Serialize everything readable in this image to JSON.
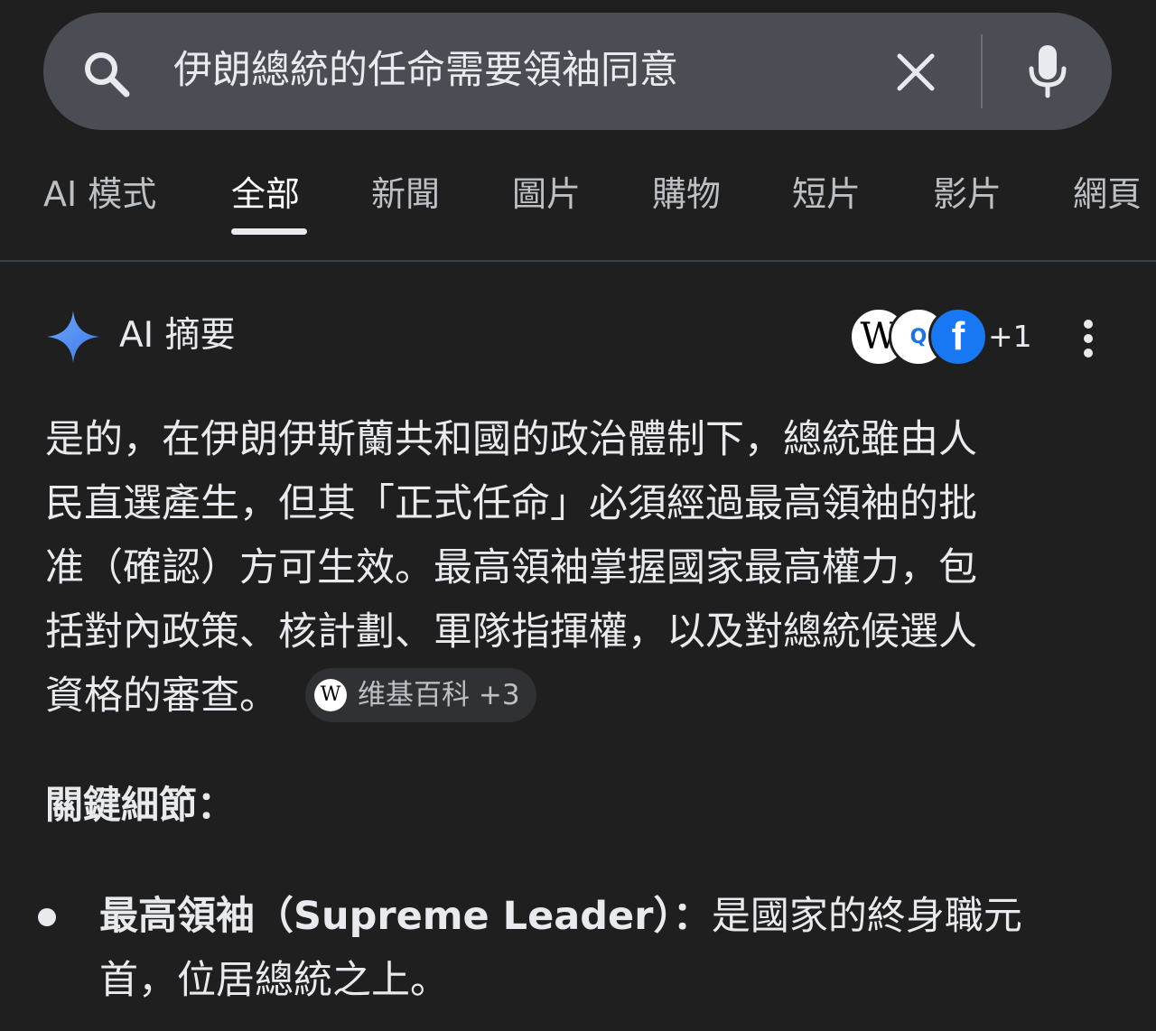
{
  "search": {
    "query": "伊朗總統的任命需要領袖同意"
  },
  "tabs": [
    {
      "label": "AI 模式"
    },
    {
      "label": "全部"
    },
    {
      "label": "新聞"
    },
    {
      "label": "圖片"
    },
    {
      "label": "購物"
    },
    {
      "label": "短片"
    },
    {
      "label": "影片"
    },
    {
      "label": "網頁"
    }
  ],
  "active_tab": "全部",
  "ai_overview": {
    "title": "AI 摘要",
    "sources": {
      "avatars": [
        "W",
        "Q",
        "f"
      ],
      "more_count": "+1"
    },
    "summary_lines": [
      "是的，在伊朗伊斯蘭共和國的政治體制下，總統雖由人",
      "民直選產生，但其「正式任命」必須經過最高領袖的批",
      "准（確認）方可生效。最高領袖掌握國家最高權力，包",
      "括對內政策、核計劃、軍隊指揮權，以及對總統候選人",
      "資格的審查。"
    ],
    "source_chip": {
      "icon": "W",
      "label": "维基百科 +3"
    },
    "details_heading": "關鍵細節：",
    "bullets": [
      {
        "strong": "最高領袖（Supreme Leader）：",
        "line1_rest": "是國家的終身職元",
        "line2": "首，位居總統之上。"
      }
    ]
  },
  "colors": {
    "background": "#1f1f1f",
    "search_bar": "#4a4e54",
    "text": "#e8eaed",
    "muted": "#bdc1c6",
    "gemini_blue": "#4a8cf7"
  }
}
